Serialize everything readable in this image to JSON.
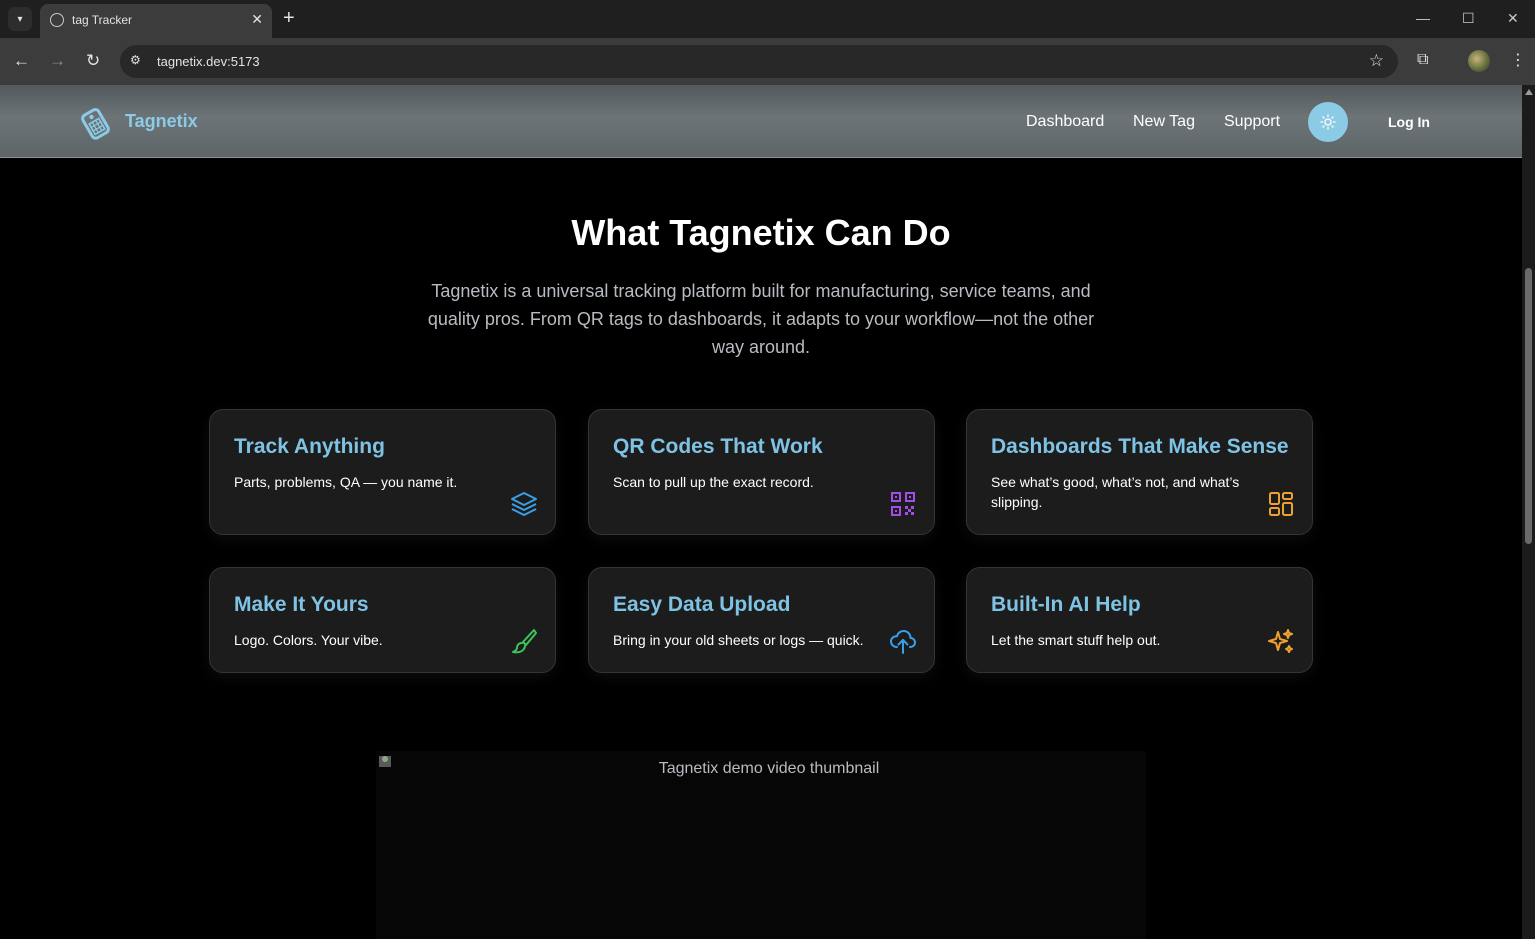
{
  "browser": {
    "tab_title": "tag Tracker",
    "url": "tagnetix.dev:5173"
  },
  "header": {
    "brand": "Tagnetix",
    "nav": [
      "Dashboard",
      "New Tag",
      "Support"
    ],
    "login": "Log In",
    "accent": "#8ccbe6"
  },
  "hero": {
    "title": "What Tagnetix Can Do",
    "description": "Tagnetix is a universal tracking platform built for manufacturing, service teams, and quality pros. From QR tags to dashboards, it adapts to your workflow—not the other way around."
  },
  "features": [
    {
      "title": "Track Anything",
      "text": "Parts, problems, QA — you name it.",
      "icon": "layers-icon",
      "icon_color": "#3b9fe8"
    },
    {
      "title": "QR Codes That Work",
      "text": "Scan to pull up the exact record.",
      "icon": "qr-code-icon",
      "icon_color": "#a24ee8"
    },
    {
      "title": "Dashboards That Make Sense",
      "text": "See what’s good, what’s not, and what’s slipping.",
      "icon": "dashboard-icon",
      "icon_color": "#f0a030"
    },
    {
      "title": "Make It Yours",
      "text": "Logo. Colors. Your vibe.",
      "icon": "brush-icon",
      "icon_color": "#3ec45a"
    },
    {
      "title": "Easy Data Upload",
      "text": "Bring in your old sheets or logs — quick.",
      "icon": "cloud-upload-icon",
      "icon_color": "#3b9fe8"
    },
    {
      "title": "Built-In AI Help",
      "text": "Let the smart stuff help out.",
      "icon": "sparkles-icon",
      "icon_color": "#f0a030"
    }
  ],
  "video": {
    "alt": "Tagnetix demo video thumbnail"
  }
}
